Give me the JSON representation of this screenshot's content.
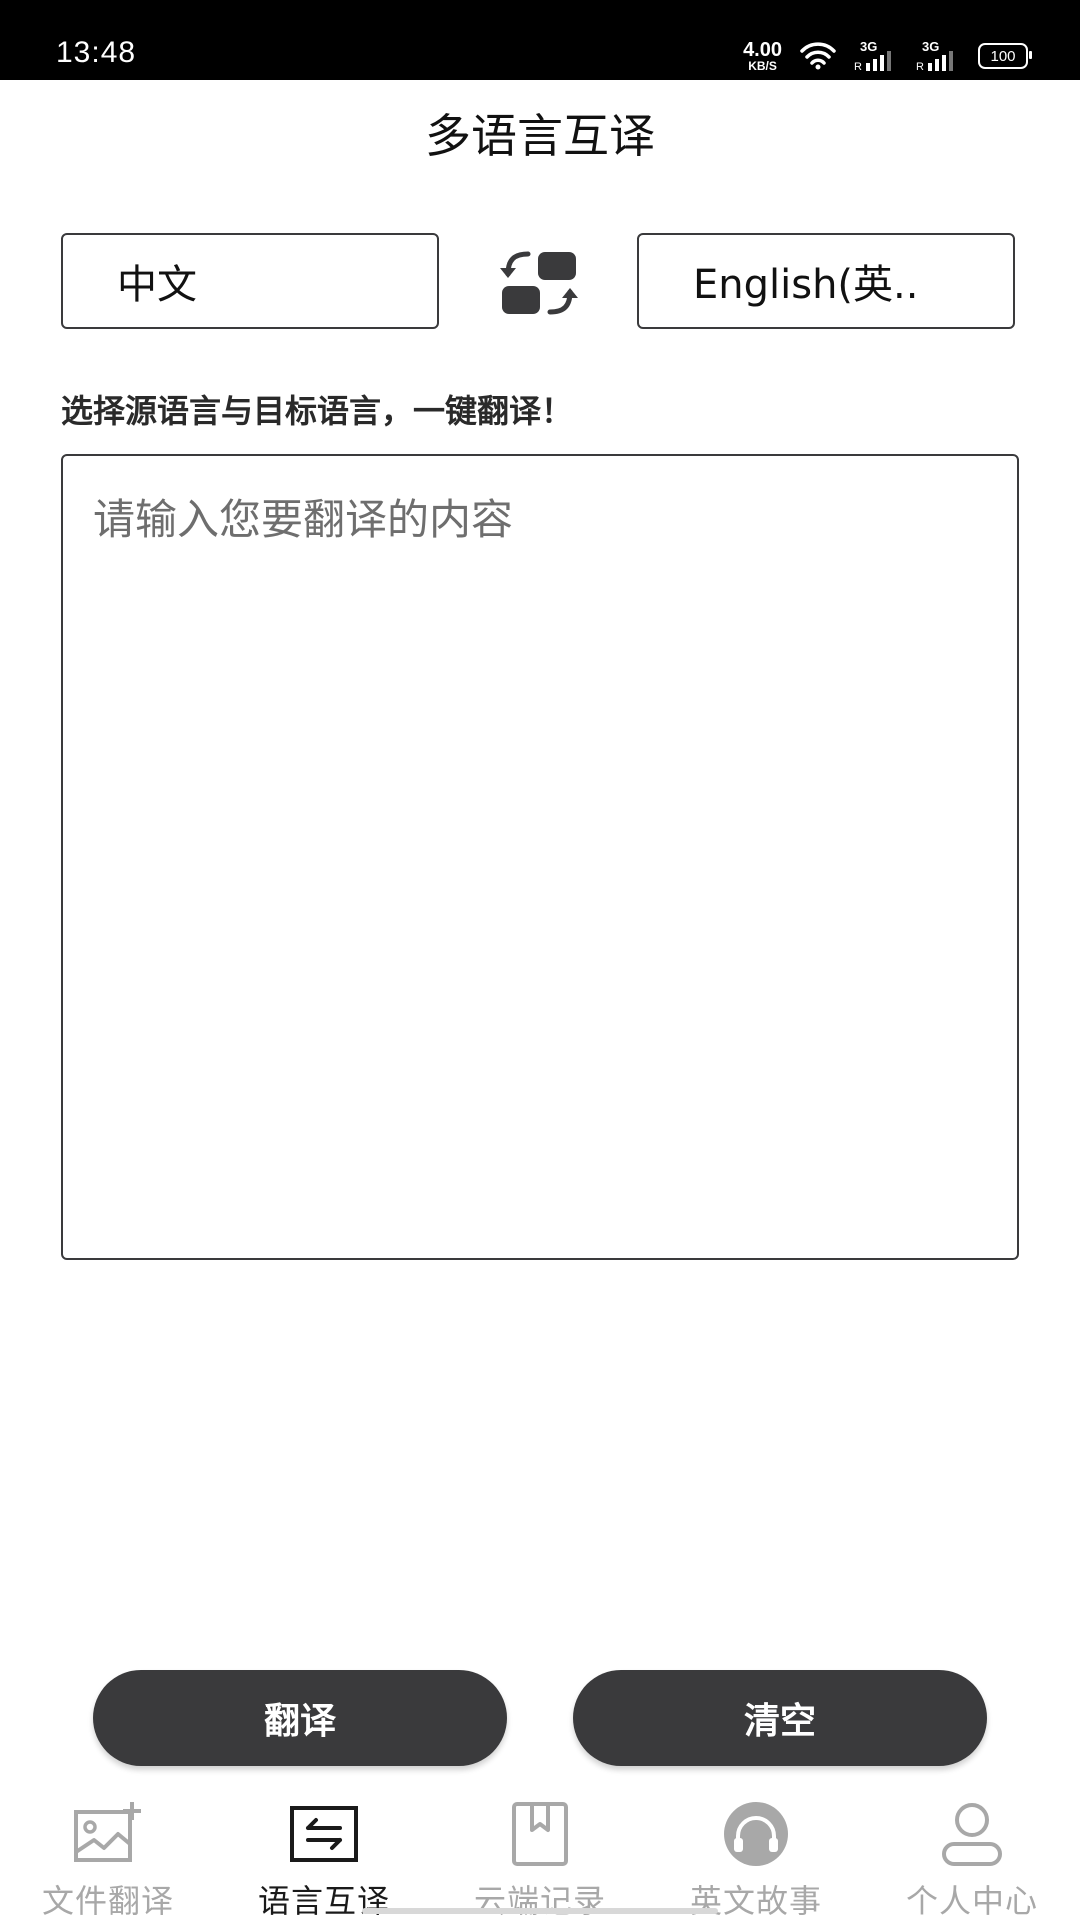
{
  "status_bar": {
    "time": "13:48",
    "net_speed": "4.00",
    "net_unit": "KB/S",
    "signal1": "3G",
    "signal2": "3G",
    "roaming": "R",
    "battery": "100"
  },
  "header": {
    "title": "多语言互译"
  },
  "languages": {
    "source": "中文",
    "target": "English(英.."
  },
  "hint": "选择源语言与目标语言，一键翻译！",
  "input": {
    "value": "",
    "placeholder": "请输入您要翻译的内容"
  },
  "actions": {
    "translate_label": "翻译",
    "clear_label": "清空"
  },
  "tabs": [
    {
      "label": "文件翻译",
      "icon": "image-add-icon",
      "active": false
    },
    {
      "label": "语言互译",
      "icon": "swap-arrows-icon",
      "active": true
    },
    {
      "label": "云端记录",
      "icon": "bookmark-book-icon",
      "active": false
    },
    {
      "label": "英文故事",
      "icon": "headphones-icon",
      "active": false
    },
    {
      "label": "个人中心",
      "icon": "person-icon",
      "active": false
    }
  ],
  "colors": {
    "accent_dark": "#3a3a3c",
    "tab_inactive": "#a8a8a8",
    "tab_active": "#1a1a1a"
  }
}
